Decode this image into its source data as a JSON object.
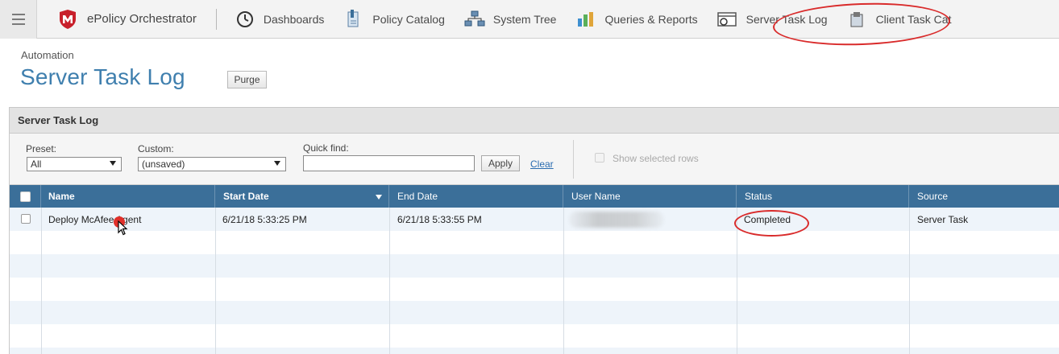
{
  "nav": {
    "brand": "ePolicy Orchestrator",
    "items": [
      {
        "label": "Dashboards",
        "icon": "gauge-icon"
      },
      {
        "label": "Policy Catalog",
        "icon": "policy-catalog-icon"
      },
      {
        "label": "System Tree",
        "icon": "system-tree-icon"
      },
      {
        "label": "Queries & Reports",
        "icon": "queries-reports-icon"
      },
      {
        "label": "Server Task Log",
        "icon": "server-task-log-icon"
      },
      {
        "label": "Client Task Cat",
        "icon": "client-task-catalog-icon"
      }
    ]
  },
  "page": {
    "breadcrumb": "Automation",
    "title": "Server Task Log",
    "purge_label": "Purge"
  },
  "panel": {
    "title": "Server Task Log",
    "preset_label": "Preset:",
    "preset_value": "All",
    "custom_label": "Custom:",
    "custom_value": "(unsaved)",
    "quick_find_label": "Quick find:",
    "quick_find_value": "",
    "apply_label": "Apply",
    "clear_label": "Clear",
    "show_selected_label": "Show selected rows"
  },
  "table": {
    "columns": [
      "Name",
      "Start Date",
      "End Date",
      "User Name",
      "Status",
      "Source"
    ],
    "rows": [
      {
        "name": "Deploy McAfee Agent",
        "start": "6/21/18 5:33:25 PM",
        "end": "6/21/18 5:33:55 PM",
        "user": "",
        "status": "Completed",
        "source": "Server Task"
      }
    ]
  },
  "colors": {
    "header_blue": "#3b6f99",
    "title_blue": "#3f7fae",
    "annotation_red": "#d92b2b",
    "brand_red": "#c8202b"
  }
}
